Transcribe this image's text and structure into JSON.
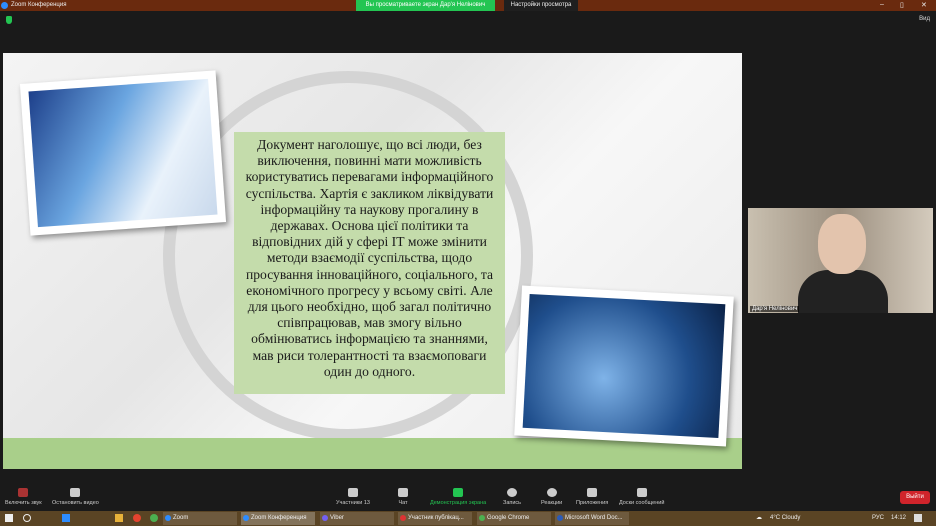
{
  "window": {
    "title": "Zoom Конференция",
    "share_notice": "Вы просматриваете экран Дар'я Нелінович",
    "view_options": "Настройки просмотра",
    "view_button": "Вид"
  },
  "slide": {
    "text": "Документ наголошує, що всі люди, без виключення, повинні мати можливість користуватись перевагами інформаційного суспільства. Хартія є закликом ліквідувати інформаційну та наукову прогалину в державах. Основа цієї політики та відповідних дій у сфері ІТ може змінити методи взаємодії суспільства, щодо просування інноваційного, соціального, та економічного прогресу у всьому світі. Але для цього необхідно, щоб загал політично співпрацював, мав змогу вільно обмінюватись інформацією та знаннями, мав риси толерантності та взаємоповаги один до одного."
  },
  "participant": {
    "name": "Дар'я Нелінович"
  },
  "toolbar": {
    "unmute": "Включить звук",
    "video": "Остановить видео",
    "participants": "Участники",
    "participants_count": "13",
    "chat": "Чат",
    "share": "Демонстрация экрана",
    "record": "Запись",
    "reactions": "Реакции",
    "apps": "Приложения",
    "whiteboards": "Доски сообщений",
    "leave": "Выйти"
  },
  "taskbar": {
    "items": [
      "Zoom",
      "Zoom Конференция",
      "Viber",
      "Участник публікац...",
      "Google Chrome",
      "Microsoft Word Doc..."
    ],
    "weather": "4°C  Cloudy",
    "lang": "РУС",
    "time": "14:12"
  }
}
